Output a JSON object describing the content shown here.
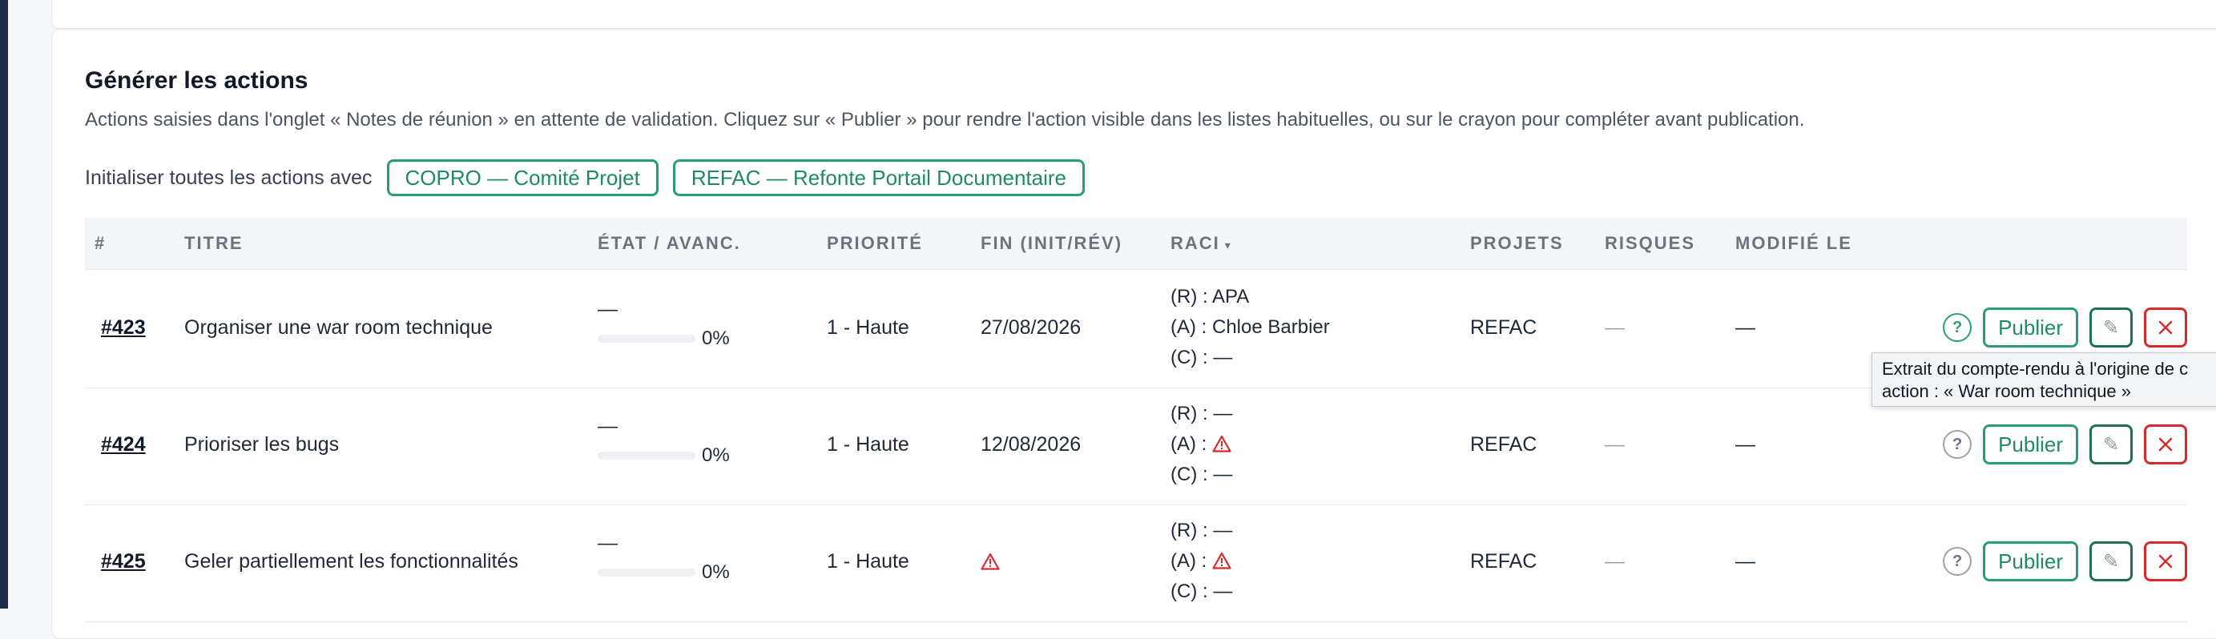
{
  "section": {
    "title": "Générer les actions",
    "description": "Actions saisies dans l'onglet « Notes de réunion » en attente de validation. Cliquez sur « Publier » pour rendre l'action visible dans les listes habituelles, ou sur le crayon pour compléter avant publication.",
    "init_label": "Initialiser toutes les actions avec",
    "init_buttons": [
      "COPRO — Comité Projet",
      "REFAC — Refonte Portail Documentaire"
    ]
  },
  "table": {
    "headers": {
      "id": "#",
      "title": "TITRE",
      "state": "ÉTAT / AVANC.",
      "priority": "PRIORITÉ",
      "end": "FIN (INIT/RÉV)",
      "raci": "RACI",
      "projects": "PROJETS",
      "risks": "RISQUES",
      "modified": "MODIFIÉ LE"
    },
    "raci_sort_icon": "caret-down",
    "rows": [
      {
        "id": "#423",
        "title": "Organiser une war room technique",
        "state": "—",
        "progress_label": "0%",
        "progress": 0,
        "priority": "1 - Haute",
        "end": "27/08/2026",
        "end_warning": false,
        "raci_r": "(R) : APA",
        "raci_a": "(A) : Chloe Barbier",
        "raci_a_warning": false,
        "raci_c": "(C) : —",
        "projects": "REFAC",
        "risks": "—",
        "modified": "—",
        "publish_label": "Publier",
        "help_active": true
      },
      {
        "id": "#424",
        "title": "Prioriser les bugs",
        "state": "—",
        "progress_label": "0%",
        "progress": 0,
        "priority": "1 - Haute",
        "end": "12/08/2026",
        "end_warning": false,
        "raci_r": "(R) : —",
        "raci_a": "(A) :",
        "raci_a_warning": true,
        "raci_c": "(C) : —",
        "projects": "REFAC",
        "risks": "—",
        "modified": "—",
        "publish_label": "Publier",
        "help_active": false
      },
      {
        "id": "#425",
        "title": "Geler partiellement les fonctionnalités",
        "state": "—",
        "progress_label": "0%",
        "progress": 0,
        "priority": "1 - Haute",
        "end": "",
        "end_warning": true,
        "raci_r": "(R) : —",
        "raci_a": "(A) :",
        "raci_a_warning": true,
        "raci_c": "(C) : —",
        "projects": "REFAC",
        "risks": "—",
        "modified": "—",
        "publish_label": "Publier",
        "help_active": false
      }
    ]
  },
  "tooltip": {
    "line1": "Extrait du compte-rendu à l'origine de c",
    "line2": "action : « War room technique »"
  },
  "colors": {
    "accent": "#2a9d78",
    "danger": "#d62b2b",
    "rail": "#1e2a4a"
  },
  "icons": {
    "help": "?",
    "edit": "✎",
    "delete": "x-icon",
    "warning": "warning-triangle-icon"
  }
}
